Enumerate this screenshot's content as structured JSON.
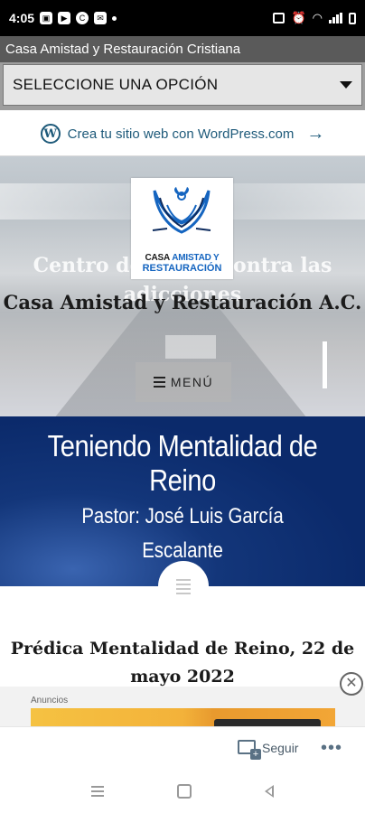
{
  "status_bar": {
    "time": "4:05"
  },
  "app": {
    "title": "Casa Amistad y Restauración Cristiana"
  },
  "select": {
    "value": "SELECCIONE UNA OPCIÓN"
  },
  "wordpress_bar": {
    "text": "Crea tu sitio web con WordPress.com",
    "logo_letter": "W"
  },
  "hero": {
    "logo_line1_a": "CASA",
    "logo_line1_b": "AMISTAD Y",
    "logo_line2": "RESTAURACIÓN",
    "background_text": "Centro de apoyo contra las adicciones",
    "site_title": "Casa Amistad y Restauración A.C.",
    "menu_label": "MENÚ"
  },
  "banner": {
    "title": "Teniendo Mentalidad de Reino",
    "pastor_line1": "Pastor: José Luis García",
    "pastor_line2": "Escalante"
  },
  "post": {
    "title": "Prédica Mentalidad de Reino, 22 de mayo 2022"
  },
  "ad": {
    "label": "Anuncios"
  },
  "follow": {
    "label": "Seguir",
    "more": "•••"
  },
  "colors": {
    "banner_blue": "#0b2a6b",
    "wp_link": "#1e5a7a",
    "title_bar": "#5a5a5a"
  }
}
